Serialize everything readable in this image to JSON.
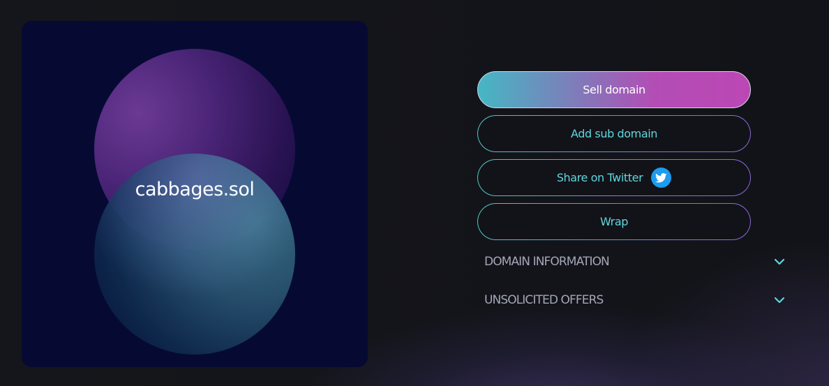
{
  "nft_card": {
    "domain_name": "cabbages.sol"
  },
  "actions": {
    "sell_label": "Sell domain",
    "add_sub_label": "Add sub domain",
    "share_label": "Share on Twitter",
    "share_icon": "twitter-icon",
    "wrap_label": "Wrap"
  },
  "sections": {
    "domain_information": {
      "label": "DOMAIN INFORMATION",
      "icon": "chevron-down-icon"
    },
    "unsolicited_offers": {
      "label": "UNSOLICITED OFFERS",
      "icon": "chevron-down-icon"
    }
  },
  "colors": {
    "background": "#121318",
    "card_background": "#060a33",
    "accent_cyan": "#5fd7e0",
    "accent_magenta": "#b34db5",
    "twitter_blue": "#1d9bf0",
    "section_label": "#a3a7b8"
  }
}
